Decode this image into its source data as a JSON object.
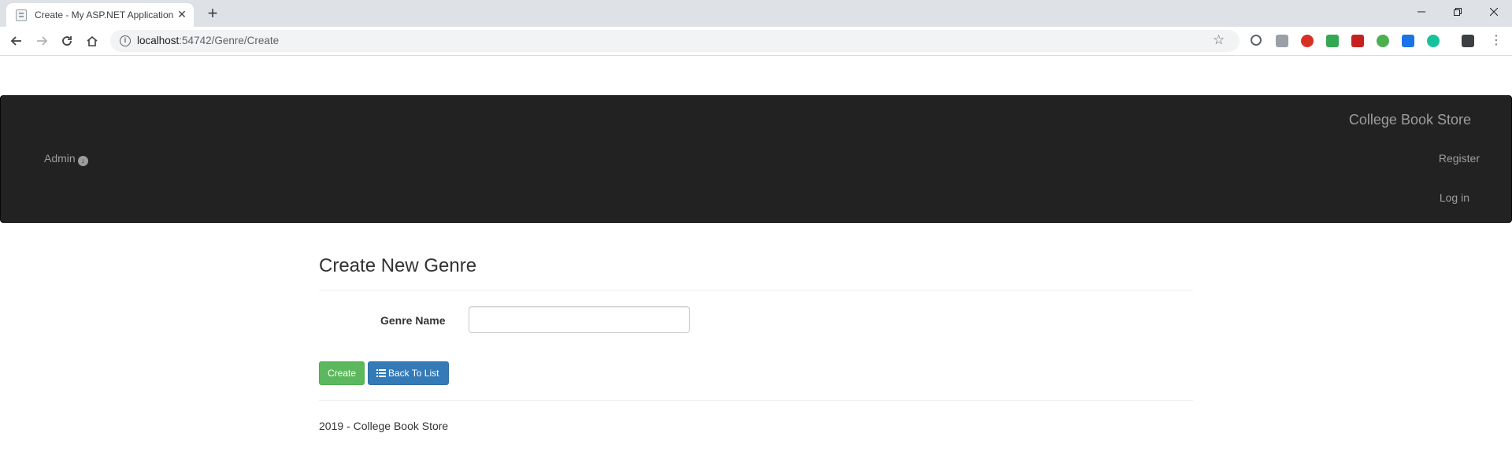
{
  "browser": {
    "tab_title": "Create - My ASP.NET Application",
    "url_host": "localhost",
    "url_path": ":54742/Genre/Create"
  },
  "navbar": {
    "brand": "College Book Store",
    "admin_label": "Admin",
    "register_label": "Register",
    "login_label": "Log in",
    "bg_color": "#222222",
    "link_color": "#9d9d9d"
  },
  "form": {
    "title": "Create New Genre",
    "genre_name_label": "Genre Name",
    "genre_name_value": "",
    "create_label": "Create",
    "back_label": "Back To List",
    "create_color": "#5cb85c",
    "back_color": "#337ab7"
  },
  "footer": {
    "text": "2019 - College Book Store"
  }
}
